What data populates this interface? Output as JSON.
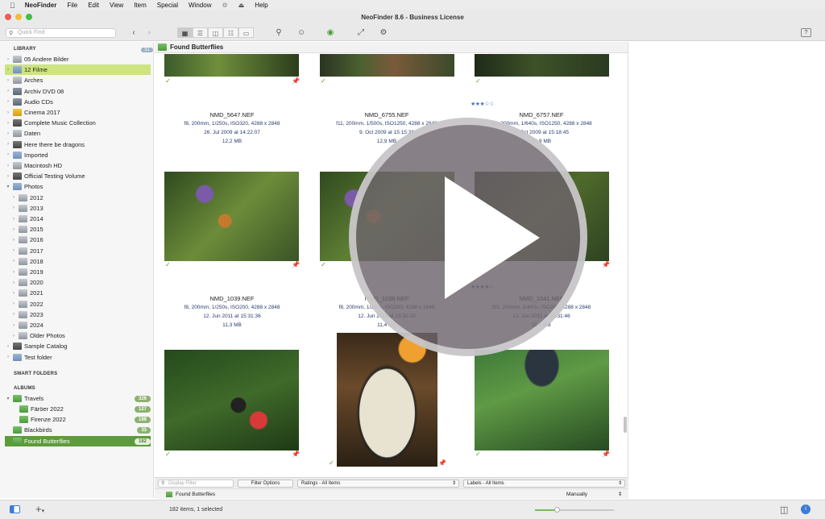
{
  "menubar": {
    "app": "NeoFinder",
    "items": [
      "File",
      "Edit",
      "View",
      "Item",
      "Special",
      "Window",
      "Help"
    ]
  },
  "window": {
    "title": "NeoFinder 8.6 - Business License"
  },
  "toolbar": {
    "quickfind_placeholder": "Quick Find",
    "help": "?"
  },
  "sidebar": {
    "library_label": "LIBRARY",
    "library_count": "31",
    "library": [
      {
        "label": "05 Andere Bilder",
        "icon": "gray"
      },
      {
        "label": "12 Filme",
        "icon": "folder",
        "highlight": true
      },
      {
        "label": "Arches",
        "icon": "gray"
      },
      {
        "label": "Archiv DVD 08",
        "icon": "cd"
      },
      {
        "label": "Audio CDs",
        "icon": "cd"
      },
      {
        "label": "Cinema 2017",
        "icon": "yellow"
      },
      {
        "label": "Complete Music Collection",
        "icon": "dark"
      },
      {
        "label": "Daten",
        "icon": "gray"
      },
      {
        "label": "Here there be dragons",
        "icon": "dark"
      },
      {
        "label": "Imported",
        "icon": "folder"
      },
      {
        "label": "Macintosh HD",
        "icon": "gray"
      },
      {
        "label": "Official Testing Volume",
        "icon": "dark"
      },
      {
        "label": "Photos",
        "icon": "folder"
      },
      {
        "label": "2012",
        "icon": "gray"
      },
      {
        "label": "2013",
        "icon": "gray"
      },
      {
        "label": "2014",
        "icon": "gray"
      },
      {
        "label": "2015",
        "icon": "gray"
      },
      {
        "label": "2016",
        "icon": "gray"
      },
      {
        "label": "2017",
        "icon": "gray"
      },
      {
        "label": "2018",
        "icon": "gray"
      },
      {
        "label": "2019",
        "icon": "gray"
      },
      {
        "label": "2020",
        "icon": "gray"
      },
      {
        "label": "2021",
        "icon": "gray"
      },
      {
        "label": "2022",
        "icon": "gray"
      },
      {
        "label": "2023",
        "icon": "gray"
      },
      {
        "label": "2024",
        "icon": "gray"
      },
      {
        "label": "Older Photos",
        "icon": "gray"
      },
      {
        "label": "Sample Catalog",
        "icon": "dark"
      },
      {
        "label": "Test folder",
        "icon": "folder"
      }
    ],
    "smart_label": "SMART FOLDERS",
    "albums_label": "ALBUMS",
    "albums": [
      {
        "label": "Travels",
        "badge": "326"
      },
      {
        "label": "Färöer 2022",
        "badge": "127"
      },
      {
        "label": "Firenze 2022",
        "badge": "199"
      },
      {
        "label": "Blackbirds",
        "badge": "33"
      },
      {
        "label": "Found Butterflies",
        "badge": "182",
        "selected": true
      }
    ]
  },
  "content": {
    "title": "Found Butterflies",
    "items": [
      {
        "file": "NMD_5647.NEF",
        "meta": "f8, 200mm, 1/250s, ISO320, 4288 x 2848",
        "date": "26. Jul 2009 at 14:22:07",
        "size": "12,2 MB"
      },
      {
        "file": "NMD_6755.NEF",
        "meta": "f11, 200mm, 1/500s, ISO1250, 4288 x 2848",
        "date": "9. Oct 2009 at 15:15:38",
        "size": "12,9 MB"
      },
      {
        "file": "NMD_6757.NEF",
        "meta": "f11, 200mm, 1/640s, ISO1250, 4288 x 2848",
        "date": "9. Oct 2009 at 15:18:45",
        "size": "12,9 MB"
      },
      {
        "file": "NMD_1039.NEF",
        "meta": "f8, 200mm, 1/250s, ISO200, 4288 x 2848",
        "date": "12. Jun 2011 at 15:31:36",
        "size": "11,3 MB"
      },
      {
        "file": "NMD_1038.NEF",
        "meta": "f8, 200mm, 1/250s, ISO200, 4288 x 2848",
        "date": "12. Jun 2011 at 15:31:29",
        "size": "11,4 MB"
      },
      {
        "file": "NMD_1041.NEF",
        "meta": "f10, 200mm, 1/400s, ISO200, 4288 x 2848",
        "date": "12. Jun 2011 at 15:31:46",
        "size": "11,4 MB"
      }
    ]
  },
  "filterbar": {
    "display_filter": "Display Filter",
    "filter_options": "Filter Options",
    "ratings": "Ratings - All Items",
    "labels": "Labels - All Items"
  },
  "pathbar": {
    "path": "Found Butterflies",
    "sort": "Manually"
  },
  "status": {
    "count": "182 items, 1 selected",
    "zoom": 0.28
  }
}
